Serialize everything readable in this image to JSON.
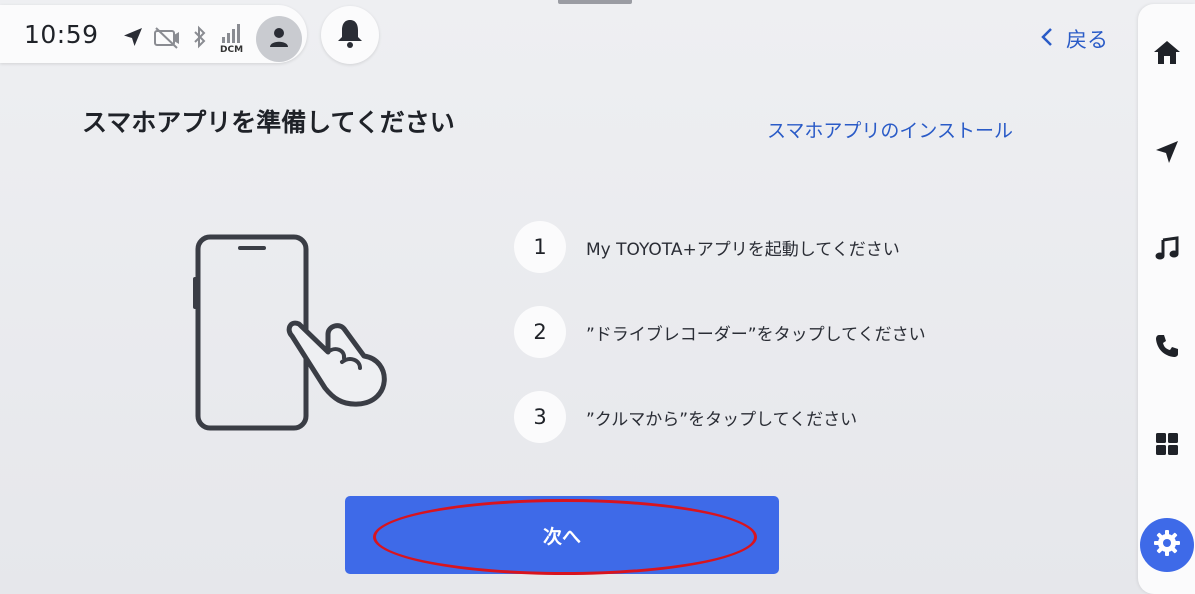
{
  "status_bar": {
    "time": "10:59",
    "dcm_label": "DCM",
    "icons": [
      "navigation-arrow-icon",
      "no-camera-icon",
      "bluetooth-icon",
      "signal-icon",
      "user-icon"
    ]
  },
  "notification": {
    "icon": "bell-icon"
  },
  "header": {
    "back_label": "戻る",
    "title": "スマホアプリを準備してください",
    "install_link": "スマホアプリのインストール"
  },
  "steps": [
    {
      "number": "1",
      "text": "My TOYOTA+アプリを起動してください"
    },
    {
      "number": "2",
      "text": "”ドライブレコーダー”をタップしてください"
    },
    {
      "number": "3",
      "text": "”クルマから”をタップしてください"
    }
  ],
  "actions": {
    "next_label": "次へ"
  },
  "sidebar": {
    "items": [
      {
        "icon": "home-icon"
      },
      {
        "icon": "navigation-icon"
      },
      {
        "icon": "music-icon"
      },
      {
        "icon": "phone-icon"
      },
      {
        "icon": "apps-grid-icon"
      },
      {
        "icon": "settings-icon",
        "active": true
      }
    ]
  },
  "colors": {
    "accent": "#3e6ae8",
    "link": "#2a5bc7",
    "highlight": "#d8141e"
  }
}
